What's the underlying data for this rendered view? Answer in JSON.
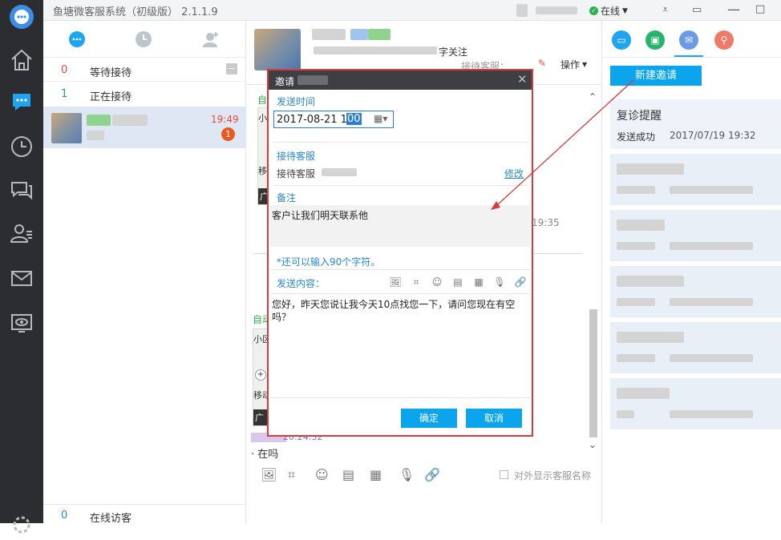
{
  "app": {
    "title": "鱼塘微客服系统（初级版） 2.1.1.9",
    "status_label": "在线"
  },
  "sessions": {
    "waiting_count": "0",
    "waiting_label": "等待接待",
    "serving_count": "1",
    "serving_label": "正在接待",
    "item_time": "19:49",
    "item_badge": "1",
    "online_count": "0",
    "online_label": "在线访客"
  },
  "chat": {
    "header_follow": "字关注",
    "header_sub": "接待客服：",
    "actions_label": "操作",
    "time_right": "19:35",
    "auto_label_1": "自",
    "auto_label_2": "自动",
    "map_text_1": "小",
    "map_text_2": "移",
    "map_text_3": "广",
    "map_text_4": "小区",
    "map_text_5": "移动",
    "map_text_6": "广",
    "last_time": "20:24:32",
    "last_message": "· 在吗",
    "show_name_label": "对外显示客服名称"
  },
  "right": {
    "new_invite_button": "新建邀请",
    "item_title": "复诊提醒",
    "item_status": "发送成功",
    "item_time": "2017/07/19 19:32"
  },
  "dialog": {
    "title": "邀请",
    "send_time_label": "发送时间",
    "datetime_value": "2017-08-21 10:00",
    "datetime_prefix": "2017-08-21 10:",
    "datetime_selected": "00",
    "receptionist_section": "接待客服",
    "receptionist_label": "接待客服",
    "modify_link": "修改",
    "note_label": "备注",
    "note_value": "客户让我们明天联系他",
    "char_hint": "*还可以输入90个字符。",
    "content_label": "发送内容：",
    "content_value": "您好，昨天您说让我今天10点找您一下，请问您现在有空吗？",
    "ok_button": "确定",
    "cancel_button": "取消"
  },
  "colors": {
    "accent_blue": "#0aa5ec",
    "annotation_red": "#d93a3a",
    "rail_bg": "#2b2d31",
    "selected_row": "#dfe7f5"
  }
}
